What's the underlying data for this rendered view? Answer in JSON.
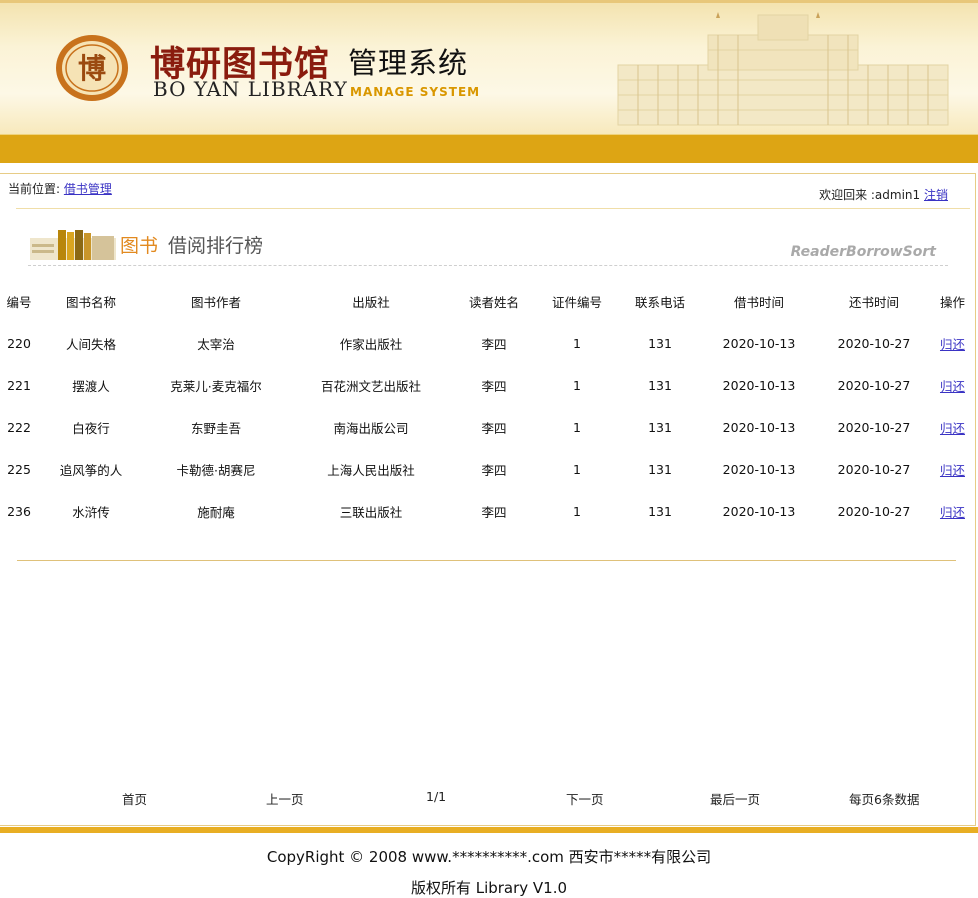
{
  "header": {
    "logo_cn": "博研图书馆",
    "logo_sub_cn": "管理系统",
    "logo_en": "BO YAN LIBRARY",
    "logo_en_sub": "MANAGE SYSTEM",
    "seal_char": "博"
  },
  "location": {
    "label": "当前位置:",
    "link": "借书管理"
  },
  "welcome": {
    "text": "欢迎回来 :admin1",
    "logout": "注销"
  },
  "section": {
    "title_a": "图书",
    "title_b": "借阅排行榜",
    "title_en": "ReaderBorrowSort"
  },
  "table": {
    "headers": [
      "编号",
      "图书名称",
      "图书作者",
      "出版社",
      "读者姓名",
      "证件编号",
      "联系电话",
      "借书时间",
      "还书时间",
      "操作"
    ],
    "rows": [
      [
        "220",
        "人间失格",
        "太宰治",
        "作家出版社",
        "李四",
        "1",
        "131",
        "2020-10-13",
        "2020-10-27",
        "归还"
      ],
      [
        "221",
        "摆渡人",
        "克莱儿·麦克福尔",
        "百花洲文艺出版社",
        "李四",
        "1",
        "131",
        "2020-10-13",
        "2020-10-27",
        "归还"
      ],
      [
        "222",
        "白夜行",
        "东野圭吾",
        "南海出版公司",
        "李四",
        "1",
        "131",
        "2020-10-13",
        "2020-10-27",
        "归还"
      ],
      [
        "225",
        "追风筝的人",
        "卡勒德·胡赛尼",
        "上海人民出版社",
        "李四",
        "1",
        "131",
        "2020-10-13",
        "2020-10-27",
        "归还"
      ],
      [
        "236",
        "水浒传",
        "施耐庵",
        "三联出版社",
        "李四",
        "1",
        "131",
        "2020-10-13",
        "2020-10-27",
        "归还"
      ]
    ]
  },
  "pager": {
    "first": "首页",
    "prev": "上一页",
    "page": "1/1",
    "next": "下一页",
    "last": "最后一页",
    "per_page": "每页6条数据"
  },
  "footer": {
    "line1": "CopyRight © 2008 www.**********.com 西安市*****有限公司",
    "line2": "版权所有 Library V1.0"
  },
  "colors": {
    "gold": "#dda514",
    "link": "#3a33c4",
    "seal": "#c8721c"
  }
}
